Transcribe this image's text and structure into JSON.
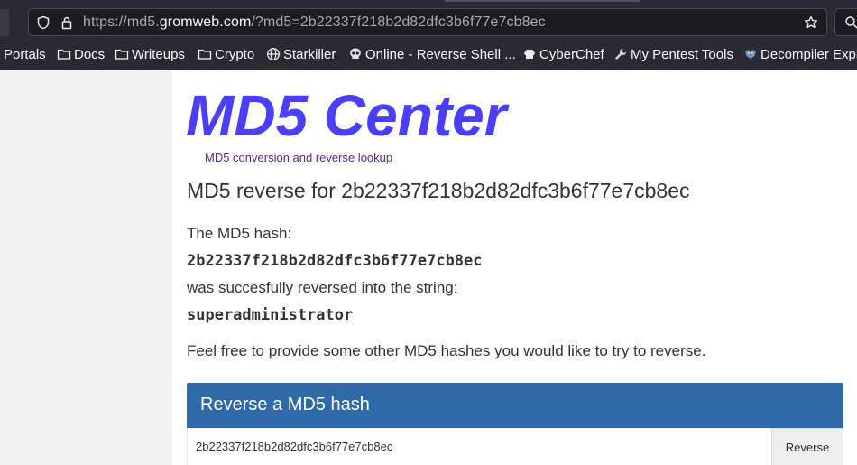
{
  "browser": {
    "url_prefix": "https://md5.",
    "url_domain": "gromweb.com",
    "url_suffix": "/?md5=2b22337f218b2d82dfc3b6f77e7cb8ec",
    "bookmarks": [
      {
        "label": "Portals",
        "icon": "none"
      },
      {
        "label": "Docs",
        "icon": "folder-icon"
      },
      {
        "label": "Writeups",
        "icon": "folder-icon"
      },
      {
        "label": "Crypto",
        "icon": "folder-icon"
      },
      {
        "label": "Starkiller",
        "icon": "globe-icon"
      },
      {
        "label": "Online - Reverse Shell ...",
        "icon": "skull-icon"
      },
      {
        "label": "CyberChef",
        "icon": "chef-hat-icon"
      },
      {
        "label": "My Pentest Tools",
        "icon": "wrench-icon"
      },
      {
        "label": "Decompiler Explo",
        "icon": "dragon-icon"
      }
    ]
  },
  "page": {
    "logo": "MD5 Center",
    "tagline": "MD5 conversion and reverse lookup",
    "heading": "MD5 reverse for 2b22337f218b2d82dfc3b6f77e7cb8ec",
    "hash_label": "The MD5 hash:",
    "hash_value": "2b22337f218b2d82dfc3b6f77e7cb8ec",
    "reversed_label": "was succesfully reversed into the string:",
    "reversed_value": "superadministrator",
    "cta": "Feel free to provide some other MD5 hashes you would like to try to reverse.",
    "panel_title": "Reverse a MD5 hash",
    "input_value": "2b22337f218b2d82dfc3b6f77e7cb8ec",
    "button_label": "Reverse"
  },
  "colors": {
    "logo": "#4a3fff",
    "tagline": "#5c2a8c",
    "panel": "#2f6aa8",
    "browser_chrome": "#2b2a33"
  }
}
